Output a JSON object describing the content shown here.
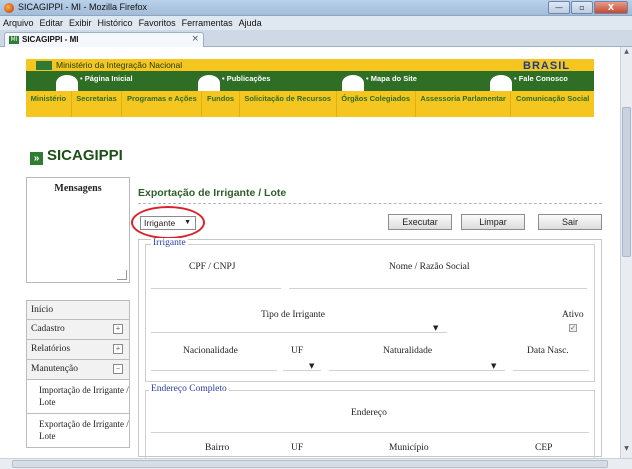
{
  "window": {
    "title": "SICAGIPPI - MI - Mozilla Firefox",
    "min": "—",
    "max": "▫",
    "close": "X"
  },
  "menubar": [
    "Arquivo",
    "Editar",
    "Exibir",
    "Histórico",
    "Favoritos",
    "Ferramentas",
    "Ajuda"
  ],
  "tab": {
    "favicon": "MI",
    "label": "SICAGIPPI - MI",
    "close": "×"
  },
  "gov": {
    "ministry": "Ministério da Integração Nacional",
    "brasil": "BRASIL",
    "nav": [
      "• Página Inicial",
      "• Publicações",
      "• Mapa do Site",
      "• Fale Conosco"
    ],
    "links": [
      "Ministério",
      "Secretarias",
      "Programas e Ações",
      "Fundos",
      "Solicitação de Recursos",
      "Órgãos Colegiados",
      "Assessoria Parlamentar",
      "Comunicação Social"
    ]
  },
  "app": {
    "title": "SICAGIPPI",
    "arrow": "»"
  },
  "sidebar": {
    "mensagens": "Mensagens",
    "menu": [
      {
        "label": "Início"
      },
      {
        "label": "Cadastro",
        "toggle": "+"
      },
      {
        "label": "Relatórios",
        "toggle": "+"
      },
      {
        "label": "Manutenção",
        "toggle": "−"
      }
    ],
    "submenu": [
      "Importação de Irrigante / Lote",
      "Exportação de Irrigante / Lote"
    ]
  },
  "main": {
    "title": "Exportação de Irrigante / Lote",
    "dropdown": "Irrigante",
    "buttons": {
      "executar": "Executar",
      "limpar": "Limpar",
      "sair": "Sair"
    },
    "irrigante": {
      "legend": "Irrigante",
      "cpf": "CPF / CNPJ",
      "nome": "Nome / Razão Social",
      "tipo": "Tipo de Irrigante",
      "ativo": "Ativo",
      "ativo_checked": "✓",
      "nacionalidade": "Nacionalidade",
      "uf": "UF",
      "naturalidade": "Naturalidade",
      "data_nasc": "Data Nasc."
    },
    "endereco": {
      "legend": "Endereço Completo",
      "endereco": "Endereço",
      "bairro": "Bairro",
      "uf": "UF",
      "municipio": "Município",
      "cep": "CEP"
    }
  }
}
